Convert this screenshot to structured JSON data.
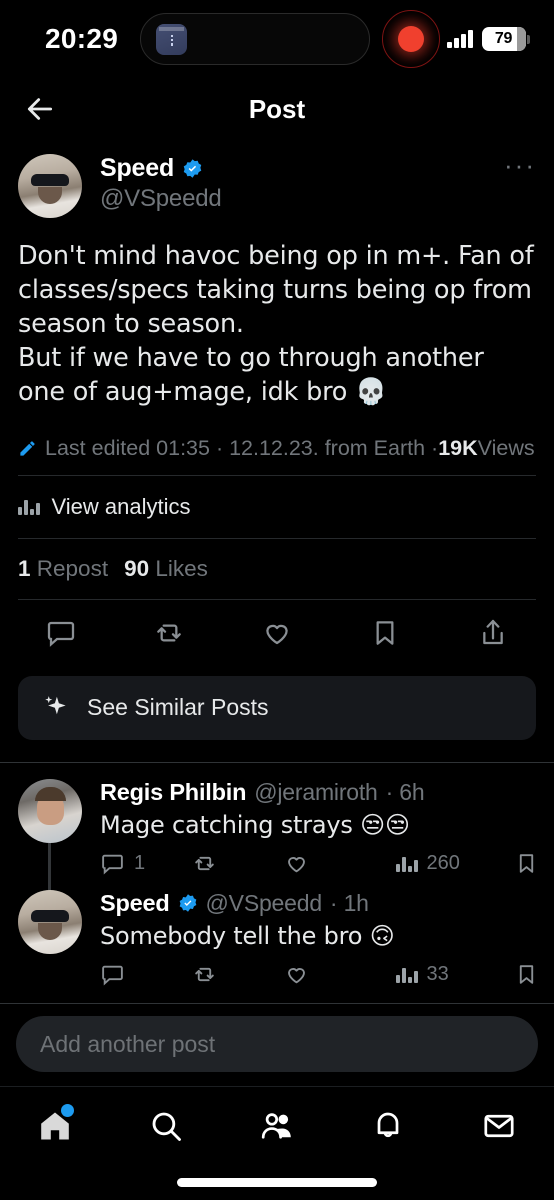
{
  "status_bar": {
    "time": "20:29",
    "battery_percent": "79",
    "icons": [
      "app-icon",
      "recording-indicator",
      "signal-bars",
      "battery"
    ]
  },
  "header": {
    "back_icon": "back-arrow-icon",
    "title": "Post"
  },
  "post": {
    "author_name": "Speed",
    "author_handle": "@VSpeedd",
    "verified": true,
    "more_label": "···",
    "text": "Don't mind havoc being op in m+. Fan of classes/specs taking turns being op from season to season.\nBut if we have to go through another one of aug+mage, idk bro 💀",
    "meta": {
      "edit_icon": "pencil-icon",
      "edited_prefix": "Last edited 01:35 · 12.12.23.  from Earth · ",
      "views_count": "19K",
      "views_label": " Views"
    },
    "analytics_label": "View analytics",
    "counts": {
      "reposts_number": "1",
      "reposts_label": "Repost",
      "likes_number": "90",
      "likes_label": "Likes"
    },
    "actions": [
      "reply-icon",
      "repost-icon",
      "like-icon",
      "bookmark-icon",
      "share-icon"
    ],
    "similar_posts_label": "See Similar Posts",
    "similar_posts_icon": "sparkle-icon"
  },
  "replies": [
    {
      "name": "Regis Philbin",
      "handle": "@jeramiroth",
      "verified": false,
      "time": "· 6h",
      "text": "Mage catching strays 😒😒",
      "reply_count": "1",
      "repost_count": "",
      "like_count": "",
      "views_count": "260"
    },
    {
      "name": "Speed",
      "handle": "@VSpeedd",
      "verified": true,
      "time": "· 1h",
      "text": "Somebody tell the bro 🙃",
      "reply_count": "",
      "repost_count": "",
      "like_count": "",
      "views_count": "33"
    }
  ],
  "compose": {
    "placeholder": "Add another post"
  },
  "navbar": {
    "items": [
      {
        "icon": "home-icon",
        "badge": true
      },
      {
        "icon": "search-icon",
        "badge": false
      },
      {
        "icon": "communities-icon",
        "badge": false
      },
      {
        "icon": "notifications-bell-icon",
        "badge": false
      },
      {
        "icon": "messages-envelope-icon",
        "badge": false
      }
    ]
  },
  "colors": {
    "background": "#000000",
    "text_primary": "#e7e9ea",
    "text_secondary": "#71767b",
    "accent_blue": "#1d9bf0",
    "surface": "#16181c",
    "divider": "#2f3336"
  }
}
